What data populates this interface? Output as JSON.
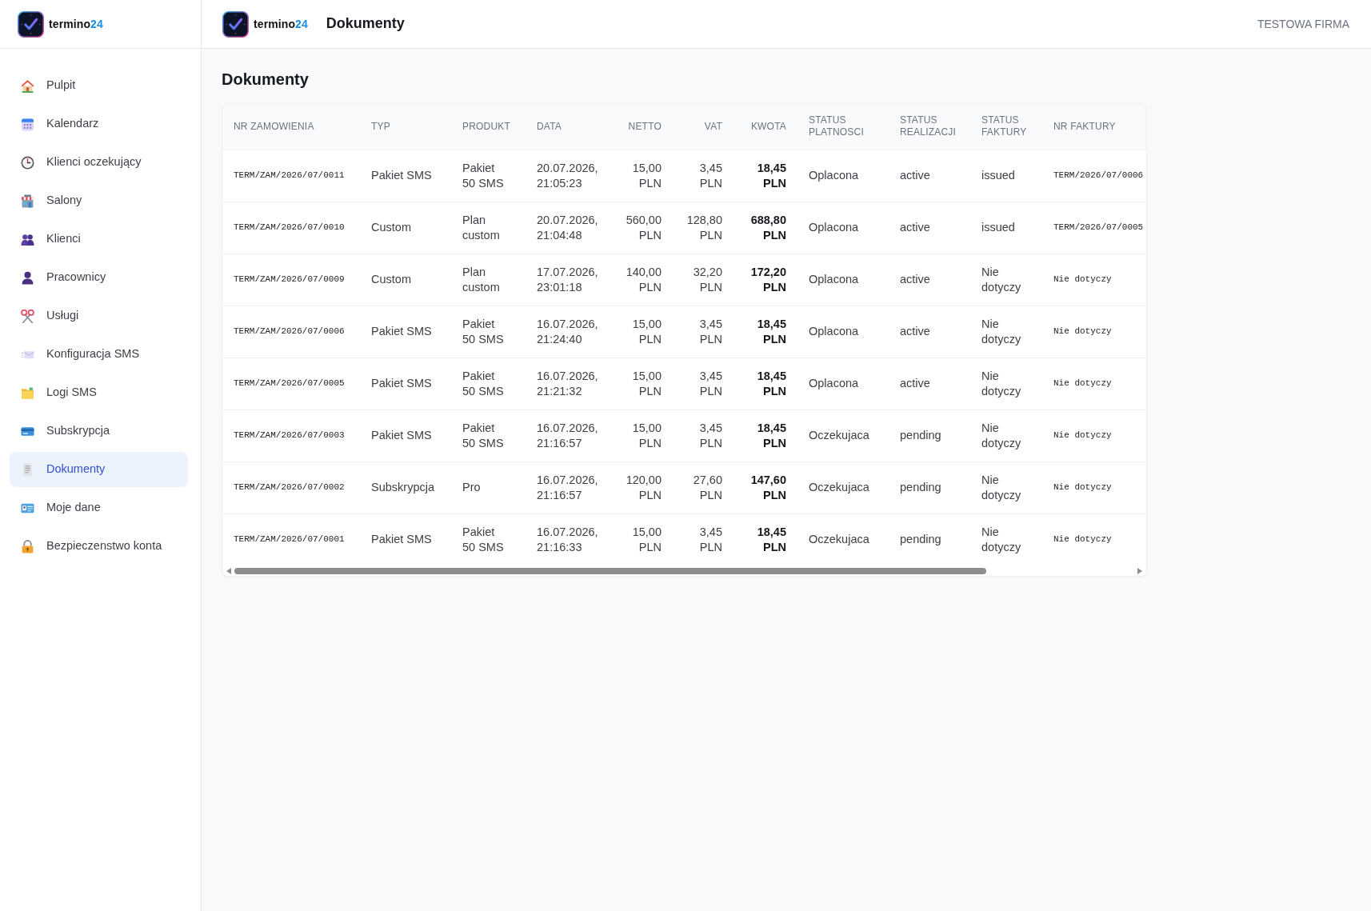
{
  "sidebar": {
    "brand": {
      "name": "termino",
      "accent": "24"
    },
    "items": [
      {
        "label": "Pulpit",
        "selected": false
      },
      {
        "label": "Kalendarz",
        "selected": false
      },
      {
        "label": "Klienci oczekujący",
        "selected": false
      },
      {
        "label": "Salony",
        "selected": false
      },
      {
        "label": "Klienci",
        "selected": false
      },
      {
        "label": "Pracownicy",
        "selected": false
      },
      {
        "label": "Usługi",
        "selected": false
      },
      {
        "label": "Konfiguracja SMS",
        "selected": false
      },
      {
        "label": "Logi SMS",
        "selected": false
      },
      {
        "label": "Subskrypcja",
        "selected": false
      },
      {
        "label": "Dokumenty",
        "selected": true
      },
      {
        "label": "Moje dane",
        "selected": false
      },
      {
        "label": "Bezpieczenstwo konta",
        "selected": false
      }
    ]
  },
  "header": {
    "brand": {
      "name": "termino",
      "accent": "24"
    },
    "title": "Dokumenty",
    "company": "TESTOWA FIRMA"
  },
  "page_title": "Dokumenty",
  "table": {
    "columns": [
      {
        "label": "NR ZAMOWIENIA",
        "kind": "code"
      },
      {
        "label": "TYP",
        "kind": "text"
      },
      {
        "label": "PRODUKT",
        "kind": "text"
      },
      {
        "label": "DATA",
        "kind": "text"
      },
      {
        "label": "NETTO",
        "kind": "money"
      },
      {
        "label": "VAT",
        "kind": "money"
      },
      {
        "label": "KWOTA",
        "kind": "total"
      },
      {
        "label": "STATUS PLATNOSCI",
        "kind": "text"
      },
      {
        "label": "STATUS REALIZACJI",
        "kind": "text"
      },
      {
        "label": "STATUS FAKTURY",
        "kind": "text"
      },
      {
        "label": "NR FAKTURY",
        "kind": "code"
      }
    ],
    "rows": [
      [
        "TERM/ZAM/2026/07/0011",
        "Pakiet SMS",
        "Pakiet 50 SMS",
        "20.07.2026, 21:05:23",
        "15,00 PLN",
        "3,45 PLN",
        "18,45 PLN",
        "Oplacona",
        "active",
        "issued",
        "TERM/2026/07/0006"
      ],
      [
        "TERM/ZAM/2026/07/0010",
        "Custom",
        "Plan custom",
        "20.07.2026, 21:04:48",
        "560,00 PLN",
        "128,80 PLN",
        "688,80 PLN",
        "Oplacona",
        "active",
        "issued",
        "TERM/2026/07/0005"
      ],
      [
        "TERM/ZAM/2026/07/0009",
        "Custom",
        "Plan custom",
        "17.07.2026, 23:01:18",
        "140,00 PLN",
        "32,20 PLN",
        "172,20 PLN",
        "Oplacona",
        "active",
        "Nie dotyczy",
        "Nie dotyczy"
      ],
      [
        "TERM/ZAM/2026/07/0006",
        "Pakiet SMS",
        "Pakiet 50 SMS",
        "16.07.2026, 21:24:40",
        "15,00 PLN",
        "3,45 PLN",
        "18,45 PLN",
        "Oplacona",
        "active",
        "Nie dotyczy",
        "Nie dotyczy"
      ],
      [
        "TERM/ZAM/2026/07/0005",
        "Pakiet SMS",
        "Pakiet 50 SMS",
        "16.07.2026, 21:21:32",
        "15,00 PLN",
        "3,45 PLN",
        "18,45 PLN",
        "Oplacona",
        "active",
        "Nie dotyczy",
        "Nie dotyczy"
      ],
      [
        "TERM/ZAM/2026/07/0003",
        "Pakiet SMS",
        "Pakiet 50 SMS",
        "16.07.2026, 21:16:57",
        "15,00 PLN",
        "3,45 PLN",
        "18,45 PLN",
        "Oczekujaca",
        "pending",
        "Nie dotyczy",
        "Nie dotyczy"
      ],
      [
        "TERM/ZAM/2026/07/0002",
        "Subskrypcja",
        "Pro",
        "16.07.2026, 21:16:57",
        "120,00 PLN",
        "27,60 PLN",
        "147,60 PLN",
        "Oczekujaca",
        "pending",
        "Nie dotyczy",
        "Nie dotyczy"
      ],
      [
        "TERM/ZAM/2026/07/0001",
        "Pakiet SMS",
        "Pakiet 50 SMS",
        "16.07.2026, 21:16:33",
        "15,00 PLN",
        "3,45 PLN",
        "18,45 PLN",
        "Oczekujaca",
        "pending",
        "Nie dotyczy",
        "Nie dotyczy"
      ]
    ]
  }
}
